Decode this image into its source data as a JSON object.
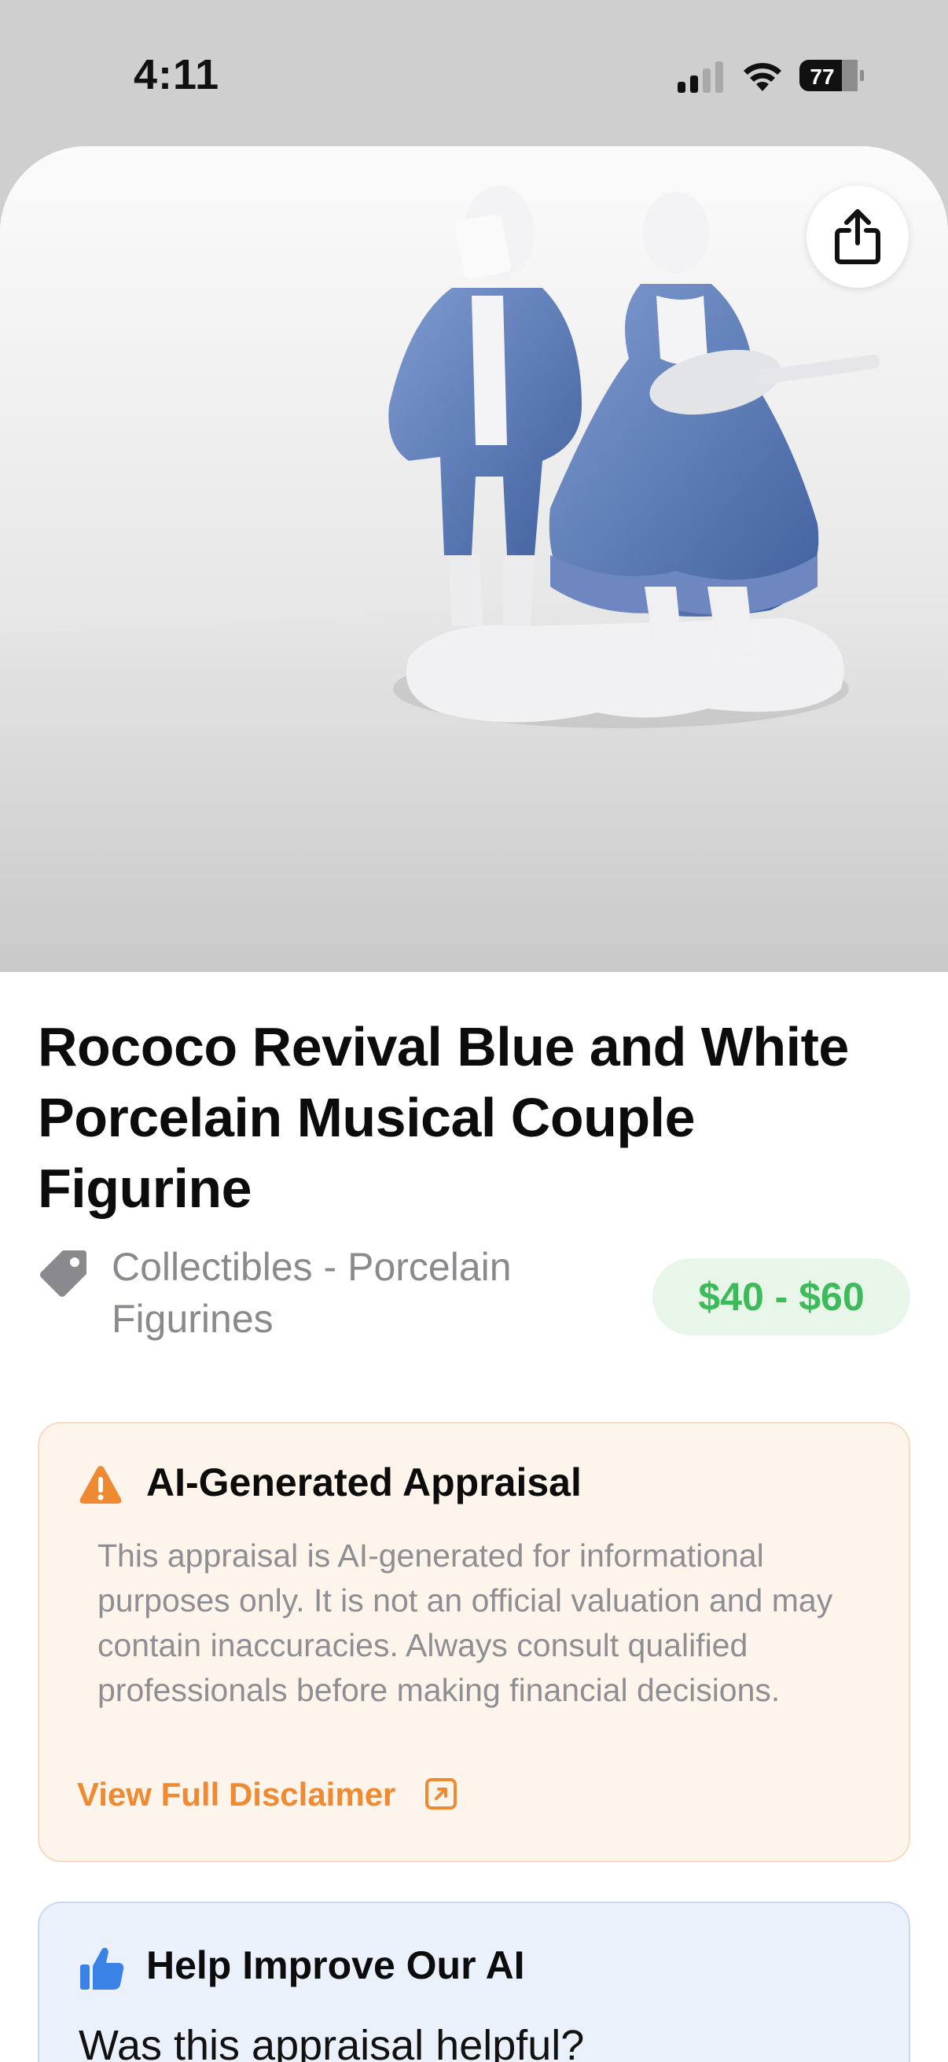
{
  "status_bar": {
    "time": "4:11",
    "battery_level": "77"
  },
  "item": {
    "photo_icon": "figurine-photo",
    "share_icon": "share-icon",
    "title": "Rococo Revival Blue and White Porcelain Musical Couple Figurine",
    "category_icon": "tag-icon",
    "category": "Collectibles - Porcelain Figurines",
    "price_range": "$40 - $60"
  },
  "disclaimer": {
    "icon": "warning-icon",
    "title": "AI-Generated Appraisal",
    "body": "This appraisal is AI-generated for informational purposes only. It is not an official valuation and may contain inaccuracies. Always consult qualified professionals before making financial decisions.",
    "link_label": "View Full Disclaimer",
    "link_icon": "external-link-icon"
  },
  "feedback": {
    "icon": "thumbs-up-icon",
    "title": "Help Improve Our AI",
    "question": "Was this appraisal helpful?"
  },
  "colors": {
    "price_text": "#3dbb5b",
    "price_bg": "#e8f6ea",
    "warning": "#ef8a33",
    "disclaimer_bg": "#fdf4ec",
    "feedback_bg": "#eaf1fb",
    "thumb": "#3b82e6"
  }
}
